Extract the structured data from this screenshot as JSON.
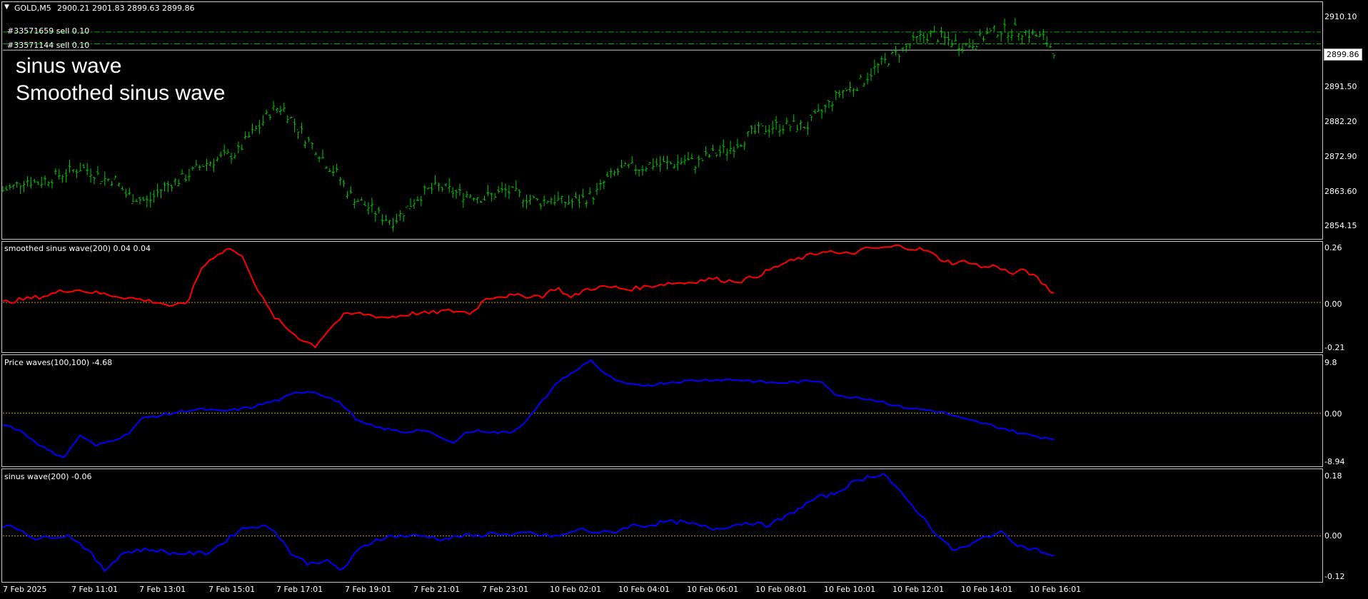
{
  "header": {
    "symbol": "GOLD,M5",
    "ohlc": "2900.21 2901.83 2899.63 2899.86",
    "menu_icon": "triangle-down-icon"
  },
  "orders": [
    {
      "label": "#33571659 sell 0.10",
      "price": 2904.6
    },
    {
      "label": "#33571144 sell 0.10",
      "price": 2901.5
    }
  ],
  "overlay_text": [
    "sinus wave",
    "Smoothed sinus wave"
  ],
  "current_price": "2899.86",
  "colors": {
    "candles": "#00c800",
    "smoothed": "#ff0000",
    "blue": "#0000ff",
    "zero": "#c8a000",
    "orders": "#00b000"
  },
  "x_axis": {
    "labels": [
      "7 Feb 2025",
      "7 Feb 11:01",
      "7 Feb 13:01",
      "7 Feb 15:01",
      "7 Feb 17:01",
      "7 Feb 19:01",
      "7 Feb 21:01",
      "7 Feb 23:01",
      "10 Feb 02:01",
      "10 Feb 04:01",
      "10 Feb 06:01",
      "10 Feb 08:01",
      "10 Feb 10:01",
      "10 Feb 12:01",
      "10 Feb 14:01",
      "10 Feb 16:01"
    ]
  },
  "chart_data": [
    {
      "type": "ohlc",
      "title": "GOLD,M5",
      "yticks": [
        "2910.10",
        "2899.86",
        "2891.50",
        "2882.20",
        "2872.90",
        "2863.60",
        "2854.15"
      ],
      "ylim": [
        2852,
        2911.5
      ],
      "series": [
        {
          "values": [
            2863,
            2864,
            2866,
            2865,
            2866,
            2867,
            2868,
            2869,
            2868,
            2866,
            2866,
            2862,
            2861,
            2860,
            2863,
            2865,
            2866,
            2868,
            2870,
            2871,
            2872,
            2873,
            2877,
            2880,
            2884,
            2885,
            2881,
            2877,
            2874,
            2870,
            2867,
            2862,
            2860,
            2858,
            2856,
            2855,
            2858,
            2861,
            2863,
            2864,
            2863,
            2862,
            2862,
            2861,
            2862,
            2863,
            2862,
            2861,
            2860,
            2861,
            2860,
            2860,
            2861,
            2862,
            2866,
            2868,
            2869,
            2869,
            2870,
            2870,
            2870,
            2871,
            2870,
            2872,
            2873,
            2874,
            2876,
            2878,
            2879,
            2880,
            2880,
            2880,
            2880,
            2883,
            2886,
            2889,
            2890,
            2892,
            2895,
            2897,
            2899,
            2901,
            2903,
            2904,
            2903,
            2902,
            2901,
            2902,
            2904,
            2905,
            2905,
            2905,
            2904,
            2903,
            2900
          ]
        }
      ]
    },
    {
      "type": "line",
      "title": "smoothed sinus wave(200) 0.04 0.04",
      "yticks": [
        "0.26",
        "0.00",
        "-0.21"
      ],
      "ylim": [
        -0.21,
        0.26
      ],
      "series": [
        {
          "name": "smoothed sinus wave(200)",
          "values": [
            0.0,
            0.01,
            0.02,
            0.03,
            0.05,
            0.06,
            0.05,
            0.04,
            0.03,
            0.02,
            0.01,
            0.0,
            -0.02,
            0.0,
            0.16,
            0.22,
            0.25,
            0.2,
            0.05,
            -0.06,
            -0.12,
            -0.17,
            -0.2,
            -0.12,
            -0.06,
            -0.05,
            -0.06,
            -0.07,
            -0.06,
            -0.05,
            -0.05,
            -0.04,
            -0.04,
            -0.05,
            0.02,
            0.03,
            0.03,
            0.03,
            0.03,
            0.07,
            0.02,
            0.06,
            0.07,
            0.07,
            0.06,
            0.07,
            0.08,
            0.09,
            0.09,
            0.1,
            0.11,
            0.1,
            0.1,
            0.12,
            0.15,
            0.18,
            0.2,
            0.22,
            0.24,
            0.22,
            0.23,
            0.25,
            0.25,
            0.26,
            0.25,
            0.24,
            0.2,
            0.18,
            0.19,
            0.16,
            0.17,
            0.13,
            0.15,
            0.1,
            0.04
          ]
        }
      ]
    },
    {
      "type": "line",
      "title": "Price waves(100,100) -4.68",
      "yticks": [
        "9.8",
        "0.00",
        "-8.94"
      ],
      "ylim": [
        -8.94,
        9.8
      ],
      "series": [
        {
          "name": "Price waves(100,100)",
          "values": [
            -2,
            -3,
            -5,
            -7,
            -8,
            -4,
            -6,
            -5,
            -4,
            -1,
            -0.5,
            0,
            0.5,
            0.7,
            0.3,
            0.6,
            1,
            1.8,
            2.5,
            3.8,
            4,
            3,
            1.5,
            -1.5,
            -2.5,
            -3,
            -3.5,
            -3,
            -4,
            -5.5,
            -3.5,
            -3.2,
            -3.6,
            -3.4,
            -1,
            2.5,
            6,
            7.5,
            9.8,
            7,
            5.5,
            5,
            5.2,
            5.6,
            5.8,
            6,
            6.1,
            6.1,
            6,
            5.7,
            5.5,
            5.6,
            5.8,
            5.9,
            3,
            3,
            2.6,
            2,
            1.2,
            0.8,
            0.5,
            0,
            -1,
            -1.6,
            -2.3,
            -3,
            -3.8,
            -4.3,
            -4.68
          ]
        }
      ]
    },
    {
      "type": "line",
      "title": "sinus wave(200) -0.06",
      "yticks": [
        "0.18",
        "0.00",
        "-0.12"
      ],
      "ylim": [
        -0.12,
        0.18
      ],
      "series": [
        {
          "name": "sinus wave(200)",
          "values": [
            0.03,
            0.02,
            -0.01,
            0.0,
            0.0,
            -0.04,
            -0.1,
            -0.05,
            -0.04,
            -0.04,
            -0.05,
            -0.05,
            -0.05,
            -0.02,
            0.02,
            0.03,
            0.02,
            -0.05,
            -0.08,
            -0.07,
            -0.1,
            -0.04,
            -0.01,
            0.0,
            0.0,
            0.0,
            -0.01,
            0.0,
            0.0,
            0.01,
            0.0,
            0.01,
            0.0,
            0.0,
            0.02,
            0.01,
            0.01,
            0.03,
            0.03,
            0.04,
            0.04,
            0.03,
            0.02,
            0.03,
            0.04,
            0.03,
            0.05,
            0.08,
            0.11,
            0.12,
            0.15,
            0.17,
            0.18,
            0.12,
            0.07,
            0.01,
            -0.04,
            -0.03,
            0.0,
            0.01,
            -0.03,
            -0.04,
            -0.06
          ]
        }
      ]
    }
  ]
}
